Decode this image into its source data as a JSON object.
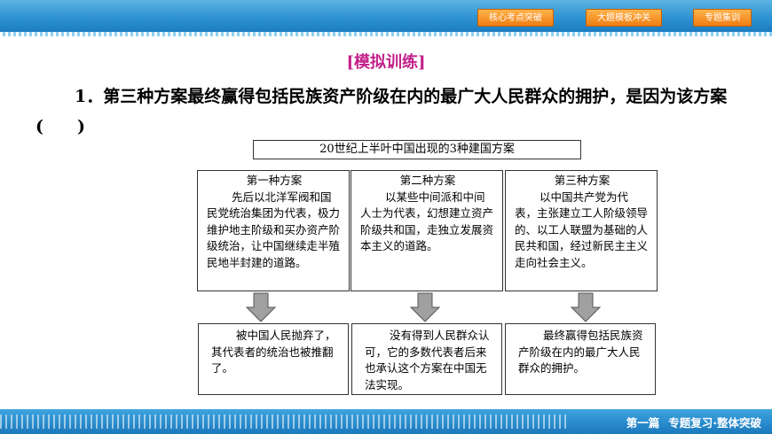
{
  "nav": {
    "items": [
      "核心考点突破",
      "大题模板冲关",
      "专题集训"
    ]
  },
  "section_title": "[模拟训练]",
  "question": {
    "text": "1．第三种方案最终赢得包括民族资产阶级在内的最广大人民群众的拥护，是因为该方案(　　)"
  },
  "diagram": {
    "header": "20世纪上半叶中国出现的3种建国方案",
    "plans": [
      {
        "title": "第一种方案",
        "body": "先后以北洋军阀和国民党统治集团为代表，极力维护地主阶级和买办资产阶级统治，让中国继续走半殖民地半封建的道路。",
        "result": "被中国人民抛弃了，其代表者的统治也被推翻了。"
      },
      {
        "title": "第二种方案",
        "body": "以某些中间派和中间人士为代表，幻想建立资产阶级共和国，走独立发展资本主义的道路。",
        "result": "没有得到人民群众认可，它的多数代表者后来也承认这个方案在中国无法实现。"
      },
      {
        "title": "第三种方案",
        "body": "以中国共产党为代表，主张建立工人阶级领导的、以工人联盟为基础的人民共和国，经过新民主主义走向社会主义。",
        "result": "最终赢得包括民族资产阶级在内的最广大人民群众的拥护。"
      }
    ]
  },
  "footer": {
    "part": "第一篇",
    "title": "专题复习·整体突破"
  },
  "colors": {
    "topbar": "#2f93d2",
    "nav_button": "#f07d12",
    "section_title": "#c3208a",
    "arrow": "#9a9a9a",
    "footer": "#1a78bd"
  }
}
